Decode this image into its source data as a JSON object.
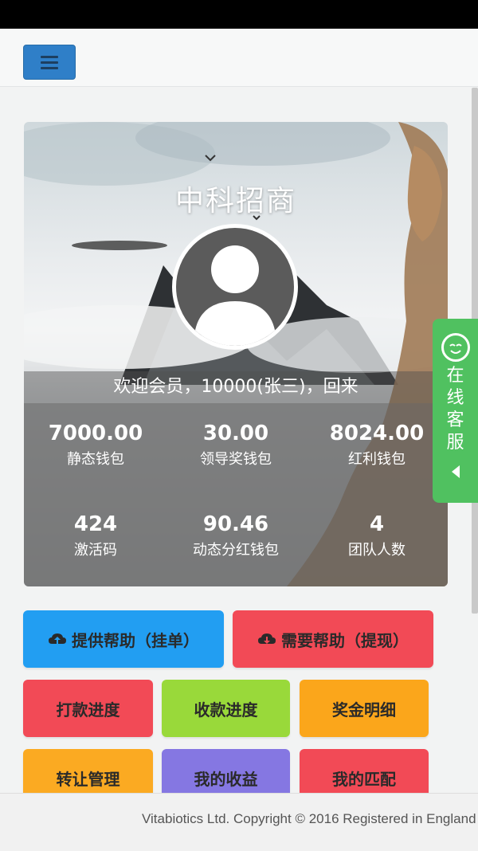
{
  "header": {
    "menu_icon": "hamburger-icon"
  },
  "hero": {
    "title": "中科招商",
    "welcome": "欢迎会员，10000(张三)，回来",
    "stats": [
      {
        "value": "7000.00",
        "label": "静态钱包"
      },
      {
        "value": "30.00",
        "label": "领导奖钱包"
      },
      {
        "value": "8024.00",
        "label": "红利钱包"
      },
      {
        "value": "424",
        "label": "激活码"
      },
      {
        "value": "90.46",
        "label": "动态分红钱包"
      },
      {
        "value": "4",
        "label": "团队人数"
      }
    ]
  },
  "side_tab": {
    "chars": [
      "在",
      "线",
      "客",
      "服"
    ]
  },
  "actions": {
    "provide_help": "提供帮助（挂单）",
    "need_help": "需要帮助（提现）",
    "grid": [
      {
        "label": "打款进度",
        "color": "#f24a56"
      },
      {
        "label": "收款进度",
        "color": "#99d93a"
      },
      {
        "label": "奖金明细",
        "color": "#fba61b"
      },
      {
        "label": "转让管理",
        "color": "#fbaa22"
      },
      {
        "label": "我的收益",
        "color": "#8577e2"
      },
      {
        "label": "我的匹配",
        "color": "#f24a56"
      }
    ],
    "colors": {
      "blue": "#229ef2",
      "red": "#f24a56"
    }
  },
  "footer": {
    "text": "Vitabiotics Ltd. Copyright © 2016 Registered in England"
  }
}
